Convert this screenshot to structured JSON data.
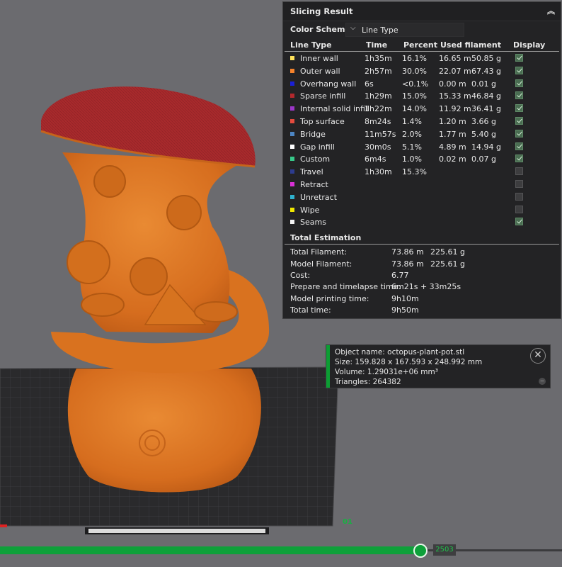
{
  "panel": {
    "title": "Slicing Result",
    "color_scheme_label": "Color Scheme",
    "color_scheme_value": "Line Type",
    "columns": [
      "Line Type",
      "Time",
      "Percent",
      "Used filament",
      "Display"
    ],
    "rows": [
      {
        "name": "Inner wall",
        "color": "#ffe25a",
        "time": "1h35m",
        "percent": "16.1%",
        "length": "16.65 m",
        "weight": "50.85 g",
        "display": true
      },
      {
        "name": "Outer wall",
        "color": "#f5832c",
        "time": "2h57m",
        "percent": "30.0%",
        "length": "22.07 m",
        "weight": "67.43 g",
        "display": true
      },
      {
        "name": "Overhang wall",
        "color": "#1a1fd6",
        "time": "6s",
        "percent": "<0.1%",
        "length": "0.00 m",
        "weight": "0.01 g",
        "display": true
      },
      {
        "name": "Sparse infill",
        "color": "#b3282d",
        "time": "1h29m",
        "percent": "15.0%",
        "length": "15.33 m",
        "weight": "46.84 g",
        "display": true
      },
      {
        "name": "Internal solid infill",
        "color": "#9c37c9",
        "time": "1h22m",
        "percent": "14.0%",
        "length": "11.92 m",
        "weight": "36.41 g",
        "display": true
      },
      {
        "name": "Top surface",
        "color": "#e44b3e",
        "time": "8m24s",
        "percent": "1.4%",
        "length": "1.20 m",
        "weight": "3.66 g",
        "display": true
      },
      {
        "name": "Bridge",
        "color": "#4d86c4",
        "time": "11m57s",
        "percent": "2.0%",
        "length": "1.77 m",
        "weight": "5.40 g",
        "display": true
      },
      {
        "name": "Gap infill",
        "color": "#ffffff",
        "time": "30m0s",
        "percent": "5.1%",
        "length": "4.89 m",
        "weight": "14.94 g",
        "display": true
      },
      {
        "name": "Custom",
        "color": "#37c98a",
        "time": "6m4s",
        "percent": "1.0%",
        "length": "0.02 m",
        "weight": "0.07 g",
        "display": true
      },
      {
        "name": "Travel",
        "color": "#2d3c8f",
        "time": "1h30m",
        "percent": "15.3%",
        "length": "",
        "weight": "",
        "display": false
      },
      {
        "name": "Retract",
        "color": "#d930d6",
        "time": "",
        "percent": "",
        "length": "",
        "weight": "",
        "display": false
      },
      {
        "name": "Unretract",
        "color": "#2fb2cf",
        "time": "",
        "percent": "",
        "length": "",
        "weight": "",
        "display": false
      },
      {
        "name": "Wipe",
        "color": "#f1e800",
        "time": "",
        "percent": "",
        "length": "",
        "weight": "",
        "display": false
      },
      {
        "name": "Seams",
        "color": "#f4f4f4",
        "time": "",
        "percent": "",
        "length": "",
        "weight": "",
        "display": true
      }
    ],
    "total_title": "Total Estimation",
    "totals": [
      {
        "label": "Total Filament:",
        "v1": "73.86 m",
        "v2": "225.61 g"
      },
      {
        "label": "Model Filament:",
        "v1": "73.86 m",
        "v2": "225.61 g"
      },
      {
        "label": "Cost:",
        "v1": "6.77",
        "v2": ""
      },
      {
        "label": "Prepare and timelapse time:",
        "v1": "6m21s + 33m25s",
        "v2": ""
      },
      {
        "label": "Model printing time:",
        "v1": "9h10m",
        "v2": ""
      },
      {
        "label": "Total time:",
        "v1": "9h50m",
        "v2": ""
      }
    ]
  },
  "object_info": {
    "name": "Object name: octopus-plant-pot.stl",
    "size": "Size: 159.828 x 167.593 x 248.992 mm",
    "volume": "Volume: 1.29031e+06 mm³",
    "triangles": "Triangles: 264382"
  },
  "slider": {
    "value": "2503",
    "fraction": 0.75
  },
  "plate_label": "01",
  "colors": {
    "accent": "#0ea03a",
    "model": "#e07a25",
    "top": "#a82a2c",
    "bed": "#2d2d2f"
  }
}
